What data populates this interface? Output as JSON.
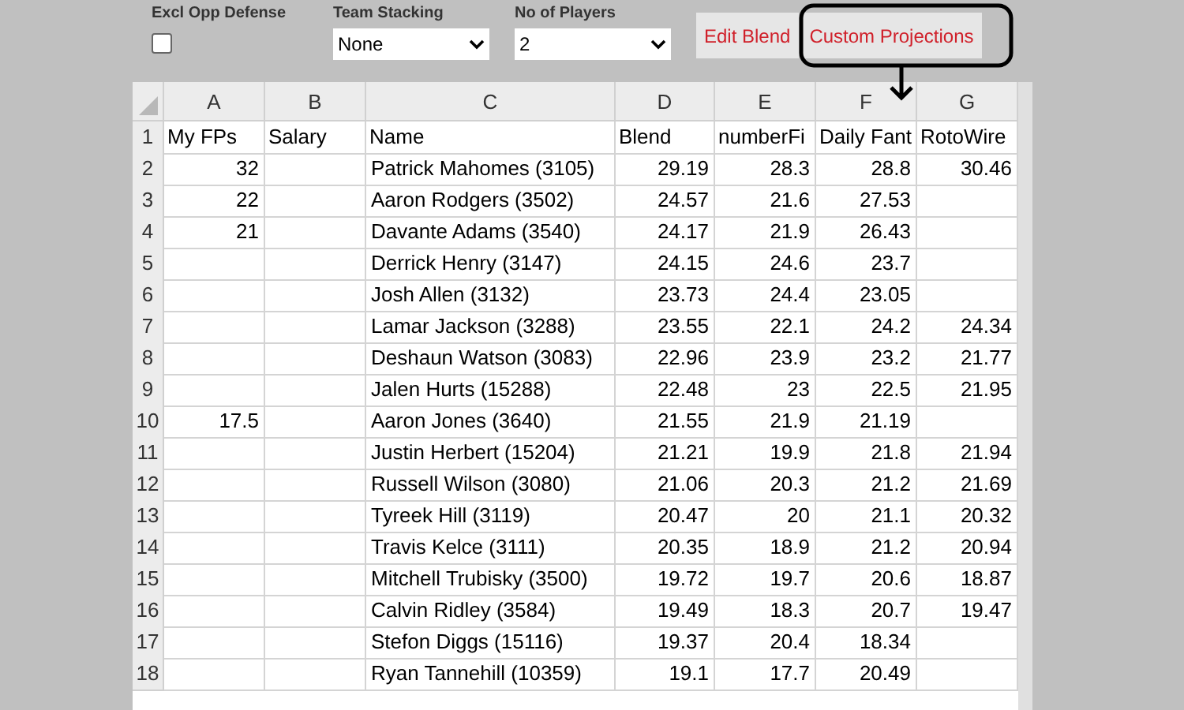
{
  "controls": {
    "excl_opp_defense": {
      "label": "Excl Opp Defense",
      "checked": false
    },
    "team_stacking": {
      "label": "Team Stacking",
      "value": "None"
    },
    "no_of_players": {
      "label": "No of Players",
      "value": "2"
    },
    "buttons": [
      {
        "label": "Edit Blend"
      },
      {
        "label": "Custom Projections"
      }
    ]
  },
  "sheet": {
    "column_letters": [
      "A",
      "B",
      "C",
      "D",
      "E",
      "F",
      "G"
    ],
    "header_row": {
      "number": "1",
      "cells": [
        "My FPs",
        "Salary",
        "Name",
        "Blend",
        "numberFi",
        "Daily Fant",
        "RotoWire"
      ]
    },
    "rows": [
      {
        "number": "2",
        "my_fps": "32",
        "name": "Patrick Mahomes (3105)",
        "blend": "29.19",
        "column_e": "28.3",
        "column_f": "28.8",
        "column_g": "30.46"
      },
      {
        "number": "3",
        "my_fps": "22",
        "name": "Aaron Rodgers (3502)",
        "blend": "24.57",
        "column_e": "21.6",
        "column_f": "27.53"
      },
      {
        "number": "4",
        "my_fps": "21",
        "name": "Davante Adams (3540)",
        "blend": "24.17",
        "column_e": "21.9",
        "column_f": "26.43"
      },
      {
        "number": "5",
        "name": "Derrick Henry (3147)",
        "blend": "24.15",
        "column_e": "24.6",
        "column_f": "23.7"
      },
      {
        "number": "6",
        "name": "Josh Allen (3132)",
        "blend": "23.73",
        "column_e": "24.4",
        "column_f": "23.05"
      },
      {
        "number": "7",
        "name": "Lamar Jackson (3288)",
        "blend": "23.55",
        "column_e": "22.1",
        "column_f": "24.2",
        "column_g": "24.34"
      },
      {
        "number": "8",
        "name": "Deshaun Watson (3083)",
        "blend": "22.96",
        "column_e": "23.9",
        "column_f": "23.2",
        "column_g": "21.77"
      },
      {
        "number": "9",
        "name": "Jalen Hurts (15288)",
        "blend": "22.48",
        "column_e": "23",
        "column_f": "22.5",
        "column_g": "21.95"
      },
      {
        "number": "10",
        "my_fps": "17.5",
        "name": "Aaron Jones (3640)",
        "blend": "21.55",
        "column_e": "21.9",
        "column_f": "21.19"
      },
      {
        "number": "11",
        "name": "Justin Herbert (15204)",
        "blend": "21.21",
        "column_e": "19.9",
        "column_f": "21.8",
        "column_g": "21.94"
      },
      {
        "number": "12",
        "name": "Russell Wilson (3080)",
        "blend": "21.06",
        "column_e": "20.3",
        "column_f": "21.2",
        "column_g": "21.69"
      },
      {
        "number": "13",
        "name": "Tyreek Hill (3119)",
        "blend": "20.47",
        "column_e": "20",
        "column_f": "21.1",
        "column_g": "20.32"
      },
      {
        "number": "14",
        "name": "Travis Kelce (3111)",
        "blend": "20.35",
        "column_e": "18.9",
        "column_f": "21.2",
        "column_g": "20.94"
      },
      {
        "number": "15",
        "name": "Mitchell Trubisky (3500)",
        "blend": "19.72",
        "column_e": "19.7",
        "column_f": "20.6",
        "column_g": "18.87"
      },
      {
        "number": "16",
        "name": "Calvin Ridley (3584)",
        "blend": "19.49",
        "column_e": "18.3",
        "column_f": "20.7",
        "column_g": "19.47"
      },
      {
        "number": "17",
        "name": "Stefon Diggs (15116)",
        "blend": "19.37",
        "column_e": "20.4",
        "column_f": "18.34"
      },
      {
        "number": "18",
        "name": "Ryan Tannehill (10359)",
        "blend": "19.1",
        "column_e": "17.7",
        "column_f": "20.49"
      }
    ]
  }
}
